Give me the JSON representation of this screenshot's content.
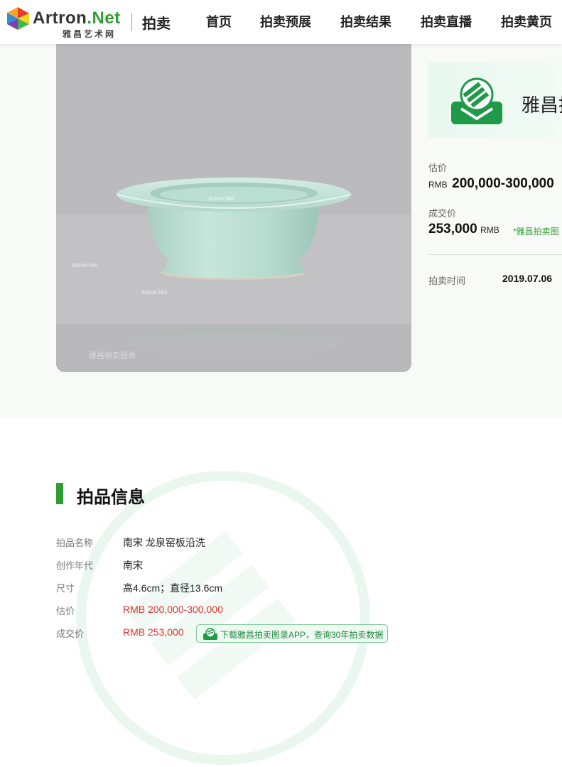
{
  "header": {
    "logo_brand_main": "Artron",
    "logo_brand_net": ".Net",
    "logo_subtitle": "雅昌艺术网",
    "section": "拍卖",
    "nav": [
      "首页",
      "拍卖预展",
      "拍卖结果",
      "拍卖直播",
      "拍卖黄页"
    ]
  },
  "photo": {
    "watermark": "Artron.Net",
    "corner_watermark": "雅昌拍卖图录"
  },
  "banner": {
    "text": "雅昌拍"
  },
  "summary": {
    "estimate_label": "估价",
    "estimate_currency": "RMB",
    "estimate_value": "200,000-300,000",
    "deal_label": "成交价",
    "deal_value": "253,000",
    "deal_currency": "RMB",
    "deal_note": "*雅昌拍卖图",
    "time_label": "拍卖时间",
    "time_value": "2019.07.06"
  },
  "info": {
    "title": "拍品信息",
    "rows": [
      {
        "label": "拍品名称",
        "value": "南宋 龙泉窑板沿洗"
      },
      {
        "label": "创作年代",
        "value": "南宋"
      },
      {
        "label": "尺寸",
        "value": "高4.6cm；直径13.6cm"
      },
      {
        "label": "估价",
        "value": "RMB 200,000-300,000"
      },
      {
        "label": "成交价",
        "value": "RMB 253,000"
      }
    ],
    "app_button": "下载雅昌拍卖图录APP，查询30年拍卖数据"
  },
  "colors": {
    "accent": "#2e9e34",
    "price_red": "#e0322b",
    "celadon": "#b9dccf"
  }
}
